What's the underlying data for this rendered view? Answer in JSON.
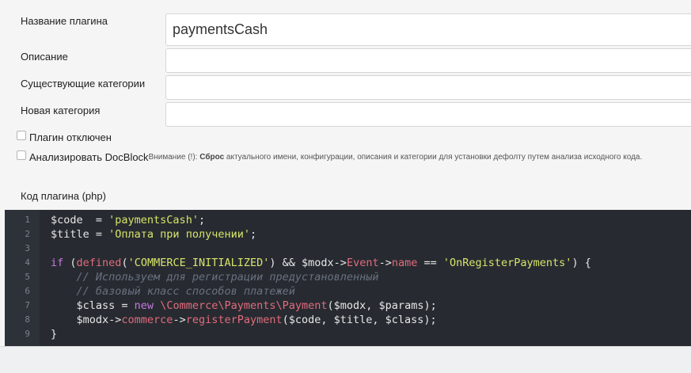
{
  "form": {
    "name_label": "Название плагина",
    "name_value": "paymentsCash",
    "description_label": "Описание",
    "description_value": "",
    "existing_categories_label": "Существующие категории",
    "new_category_label": "Новая категория",
    "disabled_label": "Плагин отключен",
    "docblock_label": "Анализировать DocBlock",
    "docblock_note_prefix": "Внимание (!): ",
    "docblock_note_bold": "Сброс",
    "docblock_note_rest": " актуального имени, конфигурации, описания и категории для установки дефолту путем анализа исходного кода.",
    "code_label": "Код плагина (php)"
  },
  "editor": {
    "line_numbers": [
      "1",
      "2",
      "3",
      "4",
      "5",
      "6",
      "7",
      "8",
      "9"
    ],
    "lines": [
      [
        {
          "t": "var",
          "v": "$code  = "
        },
        {
          "t": "str",
          "v": "'paymentsCash'"
        },
        {
          "t": "op",
          "v": ";"
        }
      ],
      [
        {
          "t": "var",
          "v": "$title = "
        },
        {
          "t": "str",
          "v": "'Оплата при получении'"
        },
        {
          "t": "op",
          "v": ";"
        }
      ],
      [],
      [
        {
          "t": "kw",
          "v": "if"
        },
        {
          "t": "op",
          "v": " ("
        },
        {
          "t": "fn",
          "v": "defined"
        },
        {
          "t": "op",
          "v": "("
        },
        {
          "t": "str",
          "v": "'COMMERCE_INITIALIZED'"
        },
        {
          "t": "op",
          "v": ") && $modx->"
        },
        {
          "t": "prop",
          "v": "Event"
        },
        {
          "t": "op",
          "v": "->"
        },
        {
          "t": "prop",
          "v": "name"
        },
        {
          "t": "op",
          "v": " == "
        },
        {
          "t": "str",
          "v": "'OnRegisterPayments'"
        },
        {
          "t": "op",
          "v": ") {"
        }
      ],
      [
        {
          "t": "op",
          "v": "    "
        },
        {
          "t": "cm",
          "v": "// Используем для регистрации предустановленный"
        }
      ],
      [
        {
          "t": "op",
          "v": "    "
        },
        {
          "t": "cm",
          "v": "// базовый класс способов платежей"
        }
      ],
      [
        {
          "t": "op",
          "v": "    $class = "
        },
        {
          "t": "kw",
          "v": "new"
        },
        {
          "t": "op",
          "v": " "
        },
        {
          "t": "ns",
          "v": "\\Commerce\\Payments\\Payment"
        },
        {
          "t": "op",
          "v": "($modx, $params);"
        }
      ],
      [
        {
          "t": "op",
          "v": "    $modx->"
        },
        {
          "t": "prop",
          "v": "commerce"
        },
        {
          "t": "op",
          "v": "->"
        },
        {
          "t": "prop",
          "v": "registerPayment"
        },
        {
          "t": "op",
          "v": "($code, $title, $class);"
        }
      ],
      [
        {
          "t": "op",
          "v": "}"
        }
      ]
    ]
  }
}
